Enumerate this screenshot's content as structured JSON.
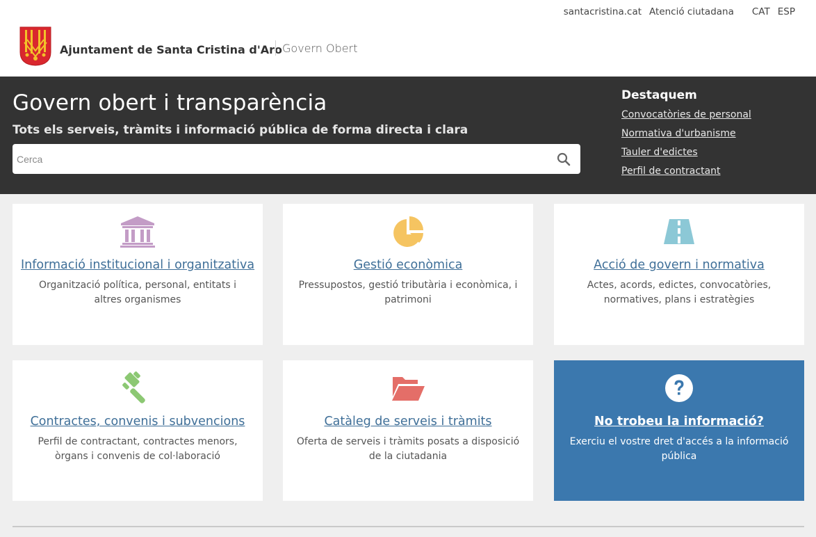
{
  "header": {
    "top_links": [
      "santacristina.cat",
      "Atenció ciutadana"
    ],
    "languages": [
      "CAT",
      "ESP"
    ],
    "brand_name": "Ajuntament de Santa Cristina d'Aro",
    "section_name": "Govern Obert",
    "crest_icon": "municipal-crest-icon"
  },
  "hero": {
    "title": "Govern obert i transparència",
    "subtitle": "Tots els serveis, tràmits i informació pública de forma directa i clara",
    "search_placeholder": "Cerca",
    "search_value": "",
    "search_icon": "search-icon",
    "highlights": {
      "title": "Destaquem",
      "links": [
        "Convocatòries de personal",
        "Normativa d'urbanisme",
        "Tauler d'edictes",
        "Perfil de contractant"
      ]
    }
  },
  "cards": [
    {
      "title": "Informació institucional i organitzativa",
      "description": "Organització política, personal, entitats i altres organismes",
      "icon": "institution-icon",
      "color": "#c39cc6"
    },
    {
      "title": "Gestió econòmica",
      "description": "Pressupostos, gestió tributària i econòmica, i patrimoni",
      "icon": "pie-chart-icon",
      "color": "#f5c461"
    },
    {
      "title": "Acció de govern i normativa",
      "description": "Actes, acords, edictes, convocatòries, normatives, plans i estratègies",
      "icon": "road-icon",
      "color": "#8cc8d6"
    },
    {
      "title": "Contractes, convenis i subvencions",
      "description": "Perfil de contractant, contractes menors, òrgans i convenis de col·laboració",
      "icon": "gavel-icon",
      "color": "#8cc873"
    },
    {
      "title": "Catàleg de serveis i tràmits",
      "description": "Oferta de serveis i tràmits posats a disposició de la ciutadania",
      "icon": "folder-open-icon",
      "color": "#e46e68"
    },
    {
      "title": "No trobeu la informació?",
      "description": "Exerciu el vostre dret d'accés a la informació pública",
      "icon": "question-circle-icon",
      "color": "#3b78ae"
    }
  ]
}
